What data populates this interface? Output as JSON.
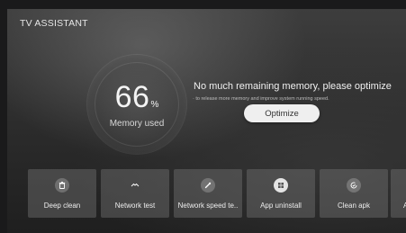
{
  "header": {
    "title": "TV ASSISTANT"
  },
  "memory": {
    "value": "66",
    "unit": "%",
    "label": "Memory used"
  },
  "message": {
    "headline": "No much remaining memory, please optimize",
    "detail": "· to release more memory and improve system running speed.",
    "button_label": "Optimize"
  },
  "tools": [
    {
      "label": "Deep clean",
      "icon": "trash-icon"
    },
    {
      "label": "Network test",
      "icon": "network-wave-icon"
    },
    {
      "label": "Network speed te..",
      "icon": "rocket-icon"
    },
    {
      "label": "App uninstall",
      "icon": "apps-grid-icon"
    },
    {
      "label": "Clean apk",
      "icon": "refresh-check-icon"
    },
    {
      "label": "A",
      "icon": "generic-icon"
    }
  ]
}
